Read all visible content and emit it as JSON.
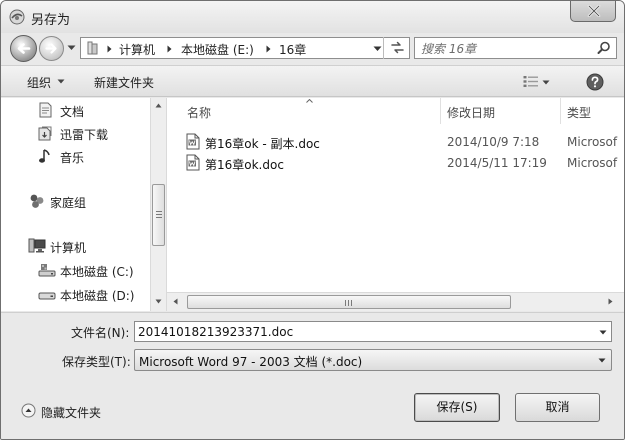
{
  "window": {
    "title": "另存为"
  },
  "address": {
    "crumbs": [
      "计算机",
      "本地磁盘 (E:)",
      "16章"
    ]
  },
  "search": {
    "placeholder": "搜索 16章"
  },
  "toolbar": {
    "organize_label": "组织",
    "new_folder_label": "新建文件夹"
  },
  "nav": {
    "items": [
      {
        "label": "文档",
        "icon": "documents-icon"
      },
      {
        "label": "迅雷下载",
        "icon": "downloads-icon"
      },
      {
        "label": "音乐",
        "icon": "music-icon"
      },
      {
        "label": "家庭组",
        "icon": "homegroup-icon"
      },
      {
        "label": "计算机",
        "icon": "computer-icon"
      },
      {
        "label": "本地磁盘 (C:)",
        "icon": "drive-c-icon"
      },
      {
        "label": "本地磁盘 (D:)",
        "icon": "drive-icon"
      }
    ]
  },
  "columns": {
    "name": "名称",
    "date": "修改日期",
    "type": "类型"
  },
  "files": [
    {
      "name": "第16章ok - 副本.doc",
      "date": "2014/10/9 7:18",
      "type": "Microsof"
    },
    {
      "name": "第16章ok.doc",
      "date": "2014/5/11 17:19",
      "type": "Microsof"
    }
  ],
  "form": {
    "filename_label": "文件名(N):",
    "filename_value": "20141018213923371.doc",
    "filetype_label": "保存类型(T):",
    "filetype_value": "Microsoft Word 97 - 2003 文档 (*.doc)"
  },
  "footer": {
    "hide_folders_label": "隐藏文件夹",
    "save_label": "保存(S)",
    "cancel_label": "取消"
  }
}
